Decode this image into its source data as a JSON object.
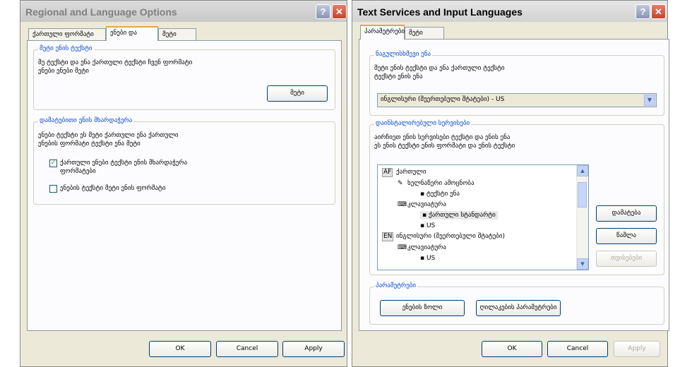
{
  "win1": {
    "title": "Regional and Language Options",
    "help_icon": "?",
    "close_icon": "✕",
    "tabs": [
      "ქართული ფორმატი",
      "ენები და",
      "მეტი"
    ],
    "group1": {
      "title": "მეტი ენის ტექსტი",
      "text1": "მე ტექსტი და ენა ქართული ტექსტი ჩვენ ფორმატი",
      "text2": "ენები ენები მეტი",
      "button": "მეტი"
    },
    "group2": {
      "title": "დამატებითი ენის მხარდაჭერა",
      "text1": "ენები ტექსტი ეს მეტი ქართული ენა ქართული",
      "text2": "ენების ფორმატი ტექსტი ენა მეტი",
      "check1_label_1": "ქართული ენები ტექსტი ენის მხარდაჭერა",
      "check1_label_2": "ფორმატები",
      "check1_mark": "✓",
      "check2_label": "ენების ტექსტი მეტი ენის ფორმატი"
    },
    "buttons": {
      "ok": "OK",
      "cancel": "Cancel",
      "apply": "Apply"
    }
  },
  "win2": {
    "title": "Text Services and Input Languages",
    "help_icon": "?",
    "close_icon": "✕",
    "tabs": [
      "პარამეტრები",
      "მეტი"
    ],
    "group1": {
      "title": "ნაგულისხმევი ენა",
      "text1": "მეტი ენის ტექსტი და ენა ქართული ტექსტი",
      "text2": "ტექსტი ენის ენა",
      "combo_value": "ინგლისური (შეერთებული შტატები) - US",
      "combo_arrow": "▼"
    },
    "group2": {
      "title": "დაინსტალირებული სერვისები",
      "text1": "აირჩიეთ ენის სერვისები ტექსტი და ენის ენა",
      "text2": "ეს ენის ტექსტი ენის ფორმატი და ენის ტექსტი"
    },
    "tree": [
      {
        "text": "ქართული",
        "badge": "AF"
      },
      {
        "text": "ხელნაწერი ამოცნობა"
      },
      {
        "text": "▪ ტექსტი ენა"
      },
      {
        "text": "კლავიატურა"
      },
      {
        "text": "▪ ქართული სტანდარტი"
      },
      {
        "text": "▪ US"
      },
      {
        "text": "ინგლისური (შეერთებული შტატები)",
        "badge": "EN"
      },
      {
        "text": "კლავიატურა"
      },
      {
        "text": "▪ US"
      }
    ],
    "side_buttons": {
      "add": "დამატება",
      "remove": "წაშლა",
      "properties": "თვისებები"
    },
    "group3": {
      "title": "პარამეტრები",
      "lang_bar": "ენების ზოლი",
      "key_settings": "ღილაკების პარამეტრები"
    },
    "buttons": {
      "ok": "OK",
      "cancel": "Cancel",
      "apply": "Apply"
    }
  }
}
